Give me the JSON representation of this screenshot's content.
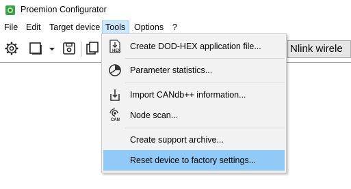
{
  "window": {
    "title": "Proemion Configurator",
    "icon": "app-logo-icon"
  },
  "menubar": {
    "items": [
      {
        "label": "File"
      },
      {
        "label": "Edit"
      },
      {
        "label": "Target device"
      },
      {
        "label": "Tools"
      },
      {
        "label": "Options"
      },
      {
        "label": "?"
      }
    ],
    "active": "Tools"
  },
  "toolbar": {
    "icons": [
      "settings-gear-icon",
      "window-icon",
      "dropdown-arrow-icon",
      "save-disk-icon",
      "copy-icon"
    ],
    "device_combo_text": "Nlink wirele"
  },
  "tools_menu": {
    "items": [
      {
        "label": "Create DOD-HEX application file...",
        "icon": "hex-file-icon",
        "icon_text": "HEX"
      },
      {
        "label": "Parameter statistics...",
        "icon": "pie-chart-icon"
      },
      {
        "label": "Import CANdb++ information...",
        "icon": "import-icon"
      },
      {
        "label": "Node scan...",
        "icon": "can-scan-icon",
        "icon_text": "CAN"
      },
      {
        "label": "Create support archive...",
        "icon": ""
      },
      {
        "label": "Reset device to factory settings...",
        "icon": "",
        "highlighted": true
      }
    ]
  },
  "colors": {
    "menu_highlight": "#91c9f7",
    "menubar_active": "#cce8ff",
    "menu_bg": "#f2f2f2"
  }
}
